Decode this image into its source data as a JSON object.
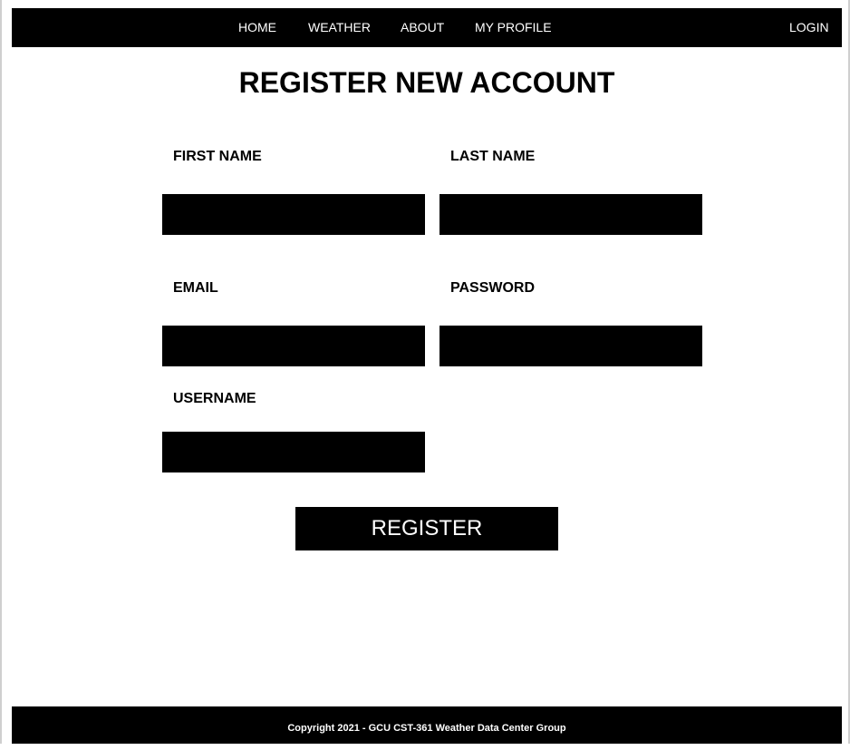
{
  "nav": {
    "home": "HOME",
    "weather": "WEATHER",
    "about": "ABOUT",
    "profile": "MY PROFILE",
    "login": "LOGIN"
  },
  "page": {
    "title": "REGISTER NEW ACCOUNT"
  },
  "form": {
    "first_name": {
      "label": "FIRST NAME",
      "value": ""
    },
    "last_name": {
      "label": "LAST NAME",
      "value": ""
    },
    "email": {
      "label": "EMAIL",
      "value": ""
    },
    "password": {
      "label": "PASSWORD",
      "value": ""
    },
    "username": {
      "label": "USERNAME",
      "value": ""
    },
    "submit_label": "REGISTER"
  },
  "footer": {
    "copyright": "Copyright 2021 - GCU CST-361 Weather Data Center Group"
  },
  "colors": {
    "bar": "#000000",
    "bar_text": "#ffffff",
    "background": "#ffffff"
  }
}
